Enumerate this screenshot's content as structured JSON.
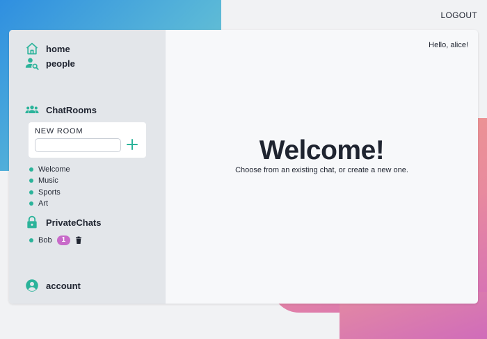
{
  "header": {
    "logout_label": "LOGOUT"
  },
  "sidebar": {
    "nav": [
      {
        "label": "home",
        "icon": "home-icon"
      },
      {
        "label": "people",
        "icon": "people-search-icon"
      }
    ],
    "chatrooms_heading": "ChatRooms",
    "new_room": {
      "label": "NEW ROOM",
      "value": "",
      "placeholder": ""
    },
    "rooms": [
      "Welcome",
      "Music",
      "Sports",
      "Art"
    ],
    "private_heading": "PrivateChats",
    "private_chats": [
      {
        "name": "Bob",
        "unread": "1"
      }
    ],
    "account_label": "account"
  },
  "main": {
    "greeting": "Hello, alice!",
    "title": "Welcome!",
    "subtitle": "Choose from an existing chat, or create a new one."
  },
  "colors": {
    "accent": "#2bb39a",
    "badge": "#c86ac9",
    "sidebar_bg": "#e3e6ea",
    "panel_bg": "#f7f8fa"
  }
}
